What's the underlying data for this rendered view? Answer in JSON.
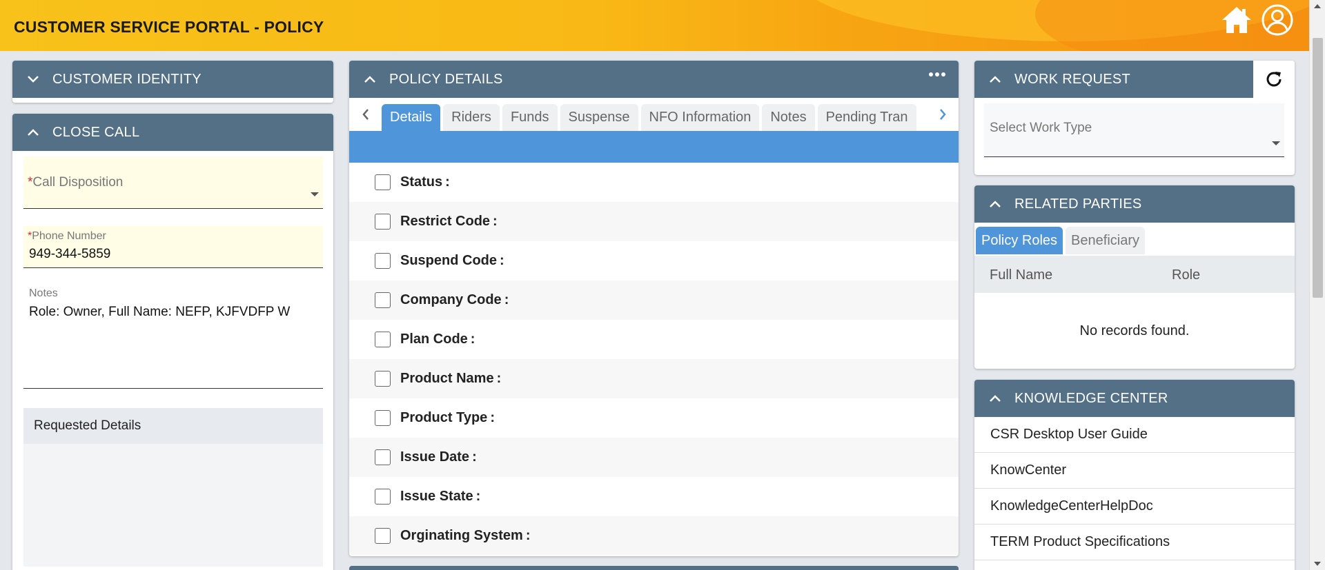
{
  "header": {
    "title": "CUSTOMER SERVICE PORTAL - POLICY",
    "icons": [
      "home-icon",
      "user-icon"
    ]
  },
  "customer_identity": {
    "title": "CUSTOMER IDENTITY",
    "collapsed": true
  },
  "close_call": {
    "title": "CLOSE CALL",
    "call_disposition_label": "Call Disposition",
    "call_disposition_value": "",
    "required_mark": "*",
    "phone_label": "Phone Number",
    "phone_value": "949-344-5859",
    "notes_label": "Notes",
    "notes_value": "Role: Owner, Full Name: NEFP, KJFVDFP W",
    "requested_details_label": "Requested Details"
  },
  "policy_details": {
    "title": "POLICY DETAILS",
    "tabs": [
      "Details",
      "Riders",
      "Funds",
      "Suspense",
      "NFO Information",
      "Notes",
      "Pending Tran"
    ],
    "active_tab": "Details",
    "rows": [
      "Status",
      "Restrict Code",
      "Suspend Code",
      "Company Code",
      "Plan Code",
      "Product Name",
      "Product Type",
      "Issue Date",
      "Issue State",
      "Orginating System"
    ]
  },
  "work_request": {
    "title": "WORK REQUEST",
    "select_placeholder": "Select Work Type"
  },
  "related_parties": {
    "title": "RELATED PARTIES",
    "tabs": [
      "Policy Roles",
      "Beneficiary"
    ],
    "active_tab": "Policy Roles",
    "columns": [
      "Full Name",
      "Role"
    ],
    "empty_message": "No records found."
  },
  "knowledge_center": {
    "title": "KNOWLEDGE CENTER",
    "links": [
      "CSR Desktop User Guide",
      "KnowCenter",
      "KnowledgeCenterHelpDoc",
      "TERM Product Specifications"
    ]
  },
  "colors": {
    "panel_header": "#537086",
    "accent_blue": "#4f95d9",
    "header_yellow": "#f8c21a",
    "header_orange": "#f59312",
    "required_field_bg": "#fffde6"
  }
}
